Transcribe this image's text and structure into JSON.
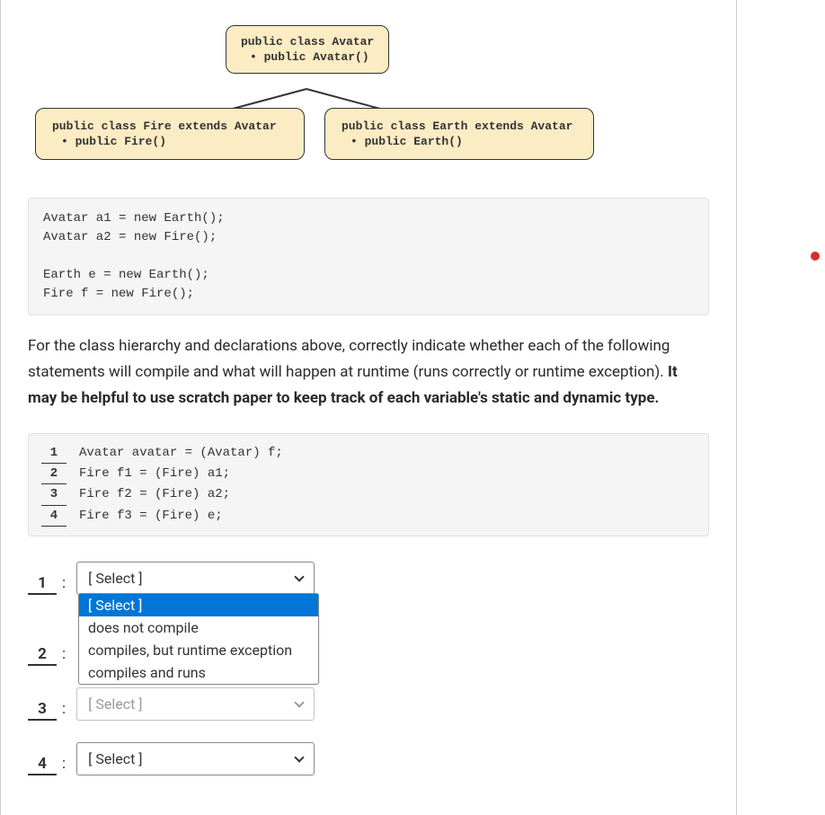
{
  "diagram": {
    "avatar": {
      "title": "public class Avatar",
      "method": "public Avatar()"
    },
    "fire": {
      "title": "public class Fire extends Avatar",
      "method": "public Fire()"
    },
    "earth": {
      "title": "public class Earth extends Avatar",
      "method": "public Earth()"
    }
  },
  "code_block": "Avatar a1 = new Earth();\nAvatar a2 = new Fire();\n\nEarth e = new Earth();\nFire f = new Fire();",
  "question": {
    "part1": "For the class hierarchy and declarations above, correctly indicate whether each of the following statements will compile and what will happen at runtime (runs correctly or runtime exception). ",
    "bold": "It may be helpful to use scratch paper to keep track of each variable's static and dynamic type."
  },
  "statements": [
    {
      "num": "1",
      "code": "Avatar avatar = (Avatar) f;"
    },
    {
      "num": "2",
      "code": "Fire f1 = (Fire) a1;"
    },
    {
      "num": "3",
      "code": "Fire f2 = (Fire) a2;"
    },
    {
      "num": "4",
      "code": "Fire f3 = (Fire) e;"
    }
  ],
  "answers": {
    "labels": [
      "1",
      "2",
      "3",
      "4"
    ],
    "placeholder": "[ Select ]",
    "options": [
      "[ Select ]",
      "does not compile",
      "compiles, but runtime exception",
      "compiles and runs"
    ]
  }
}
